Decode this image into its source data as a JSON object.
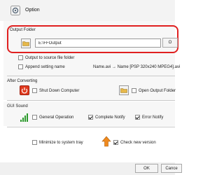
{
  "window": {
    "title": "Option"
  },
  "output_folder": {
    "section_title": "Output Folder",
    "path_value": "E:\\FFOutput",
    "browse_label": "O",
    "output_to_source_label": "Output to source file folder",
    "append_setting_label": "Append setting name",
    "example_text": "Name.avi → Name [PSP 320x240 MPEG4].avi"
  },
  "after_converting": {
    "section_title": "After Converting",
    "shutdown_label": "Shut Down Computer",
    "open_folder_label": "Open Output Folder"
  },
  "gui_sound": {
    "section_title": "GUI Sound",
    "general_operation_label": "General Operation",
    "complete_notify_label": "Complete Notify",
    "error_notify_label": "Error Notify"
  },
  "misc": {
    "minimize_tray_label": "Minimize to system tray",
    "check_version_label": "Check new version"
  },
  "footer": {
    "ok_label": "OK",
    "cancel_label": "Cance"
  },
  "states": {
    "output_to_source": false,
    "append_setting": false,
    "shutdown": false,
    "open_folder": false,
    "general_operation": false,
    "complete_notify": true,
    "error_notify": true,
    "minimize_tray": false,
    "check_version": true
  },
  "colors": {
    "highlight_border": "#e02020",
    "shutdown_red": "#e03a1e"
  },
  "icons": {
    "app": "gear-icon",
    "folder": "folder-icon",
    "shutdown": "power-icon",
    "sound": "volume-bars-icon",
    "update": "up-arrow-icon"
  }
}
